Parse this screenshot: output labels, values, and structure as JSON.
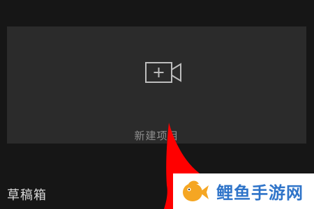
{
  "new_project": {
    "label": "新建项目",
    "icon": "video-camera-plus-icon"
  },
  "drafts": {
    "heading": "草稿箱"
  },
  "overlay": {
    "arrow_color": "#ff0000",
    "watermark_text": "鲤鱼手游网",
    "watermark_text_color": "#2f74c9",
    "logo_color": "#f5a623"
  }
}
